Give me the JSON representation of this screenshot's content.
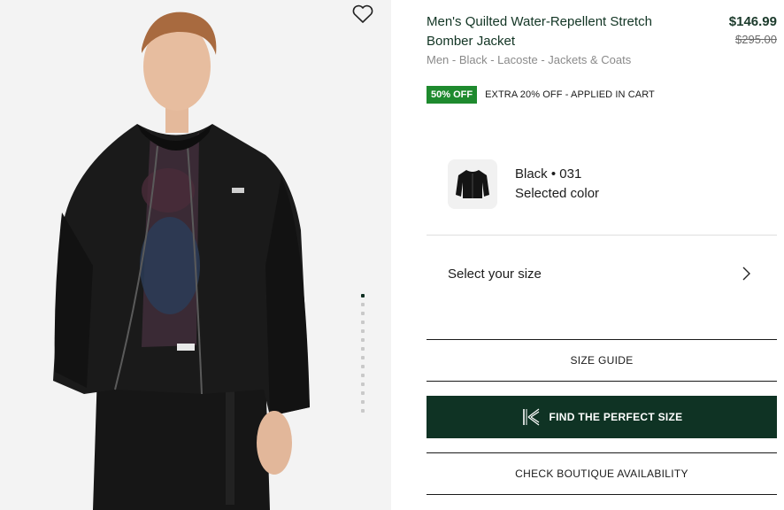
{
  "product": {
    "title": "Men's Quilted Water-Repellent Stretch Bomber Jacket",
    "breadcrumb": "Men - Black - Lacoste - Jackets & Coats",
    "price_now": "$146.99",
    "price_was": "$295.00"
  },
  "promo": {
    "badge": "50% OFF",
    "text": "EXTRA 20% OFF - APPLIED IN CART",
    "badge_color": "#1e8a2e"
  },
  "color": {
    "name": "Black • 031",
    "subtitle": "Selected color"
  },
  "size": {
    "label": "Select your size"
  },
  "buttons": {
    "size_guide": "SIZE GUIDE",
    "perfect_size": "FIND THE PERFECT SIZE",
    "boutique": "CHECK BOUTIQUE AVAILABILITY"
  },
  "gallery": {
    "dot_count": 14,
    "active_index": 0
  },
  "colors": {
    "brand_dark": "#0f3324",
    "text_green": "#123524"
  },
  "icons": {
    "wishlist": "heart-icon",
    "size_chevron": "chevron-right-icon",
    "perfect_size": "kiwi-sizing-icon"
  }
}
